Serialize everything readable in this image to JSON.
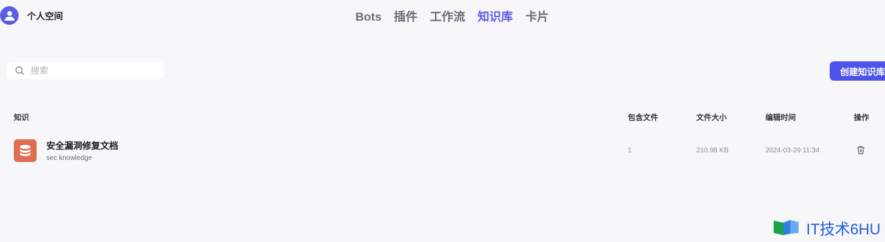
{
  "header": {
    "workspace_label": "个人空间",
    "nav": [
      {
        "label": "Bots",
        "active": false
      },
      {
        "label": "插件",
        "active": false
      },
      {
        "label": "工作流",
        "active": false
      },
      {
        "label": "知识库",
        "active": true
      },
      {
        "label": "卡片",
        "active": false
      }
    ]
  },
  "search": {
    "placeholder": "搜索",
    "value": ""
  },
  "create_button": {
    "label": "创建知识库"
  },
  "table": {
    "columns": {
      "knowledge": "知识",
      "files": "包含文件",
      "size": "文件大小",
      "edited": "编辑时间",
      "actions": "操作"
    },
    "rows": [
      {
        "name": "安全漏洞修复文档",
        "description": "sec knowledge",
        "files": "1",
        "size": "210.98 KB",
        "edited": "2024-03-29 11:34",
        "icon": "database-icon",
        "action_icon": "trash-icon"
      }
    ]
  },
  "watermark": {
    "text": "IT技术6HU"
  },
  "colors": {
    "accent": "#4d53e8",
    "active_nav": "#5b5de8",
    "kb_icon_bg": "#de6d52",
    "background": "#f7f7fa"
  }
}
